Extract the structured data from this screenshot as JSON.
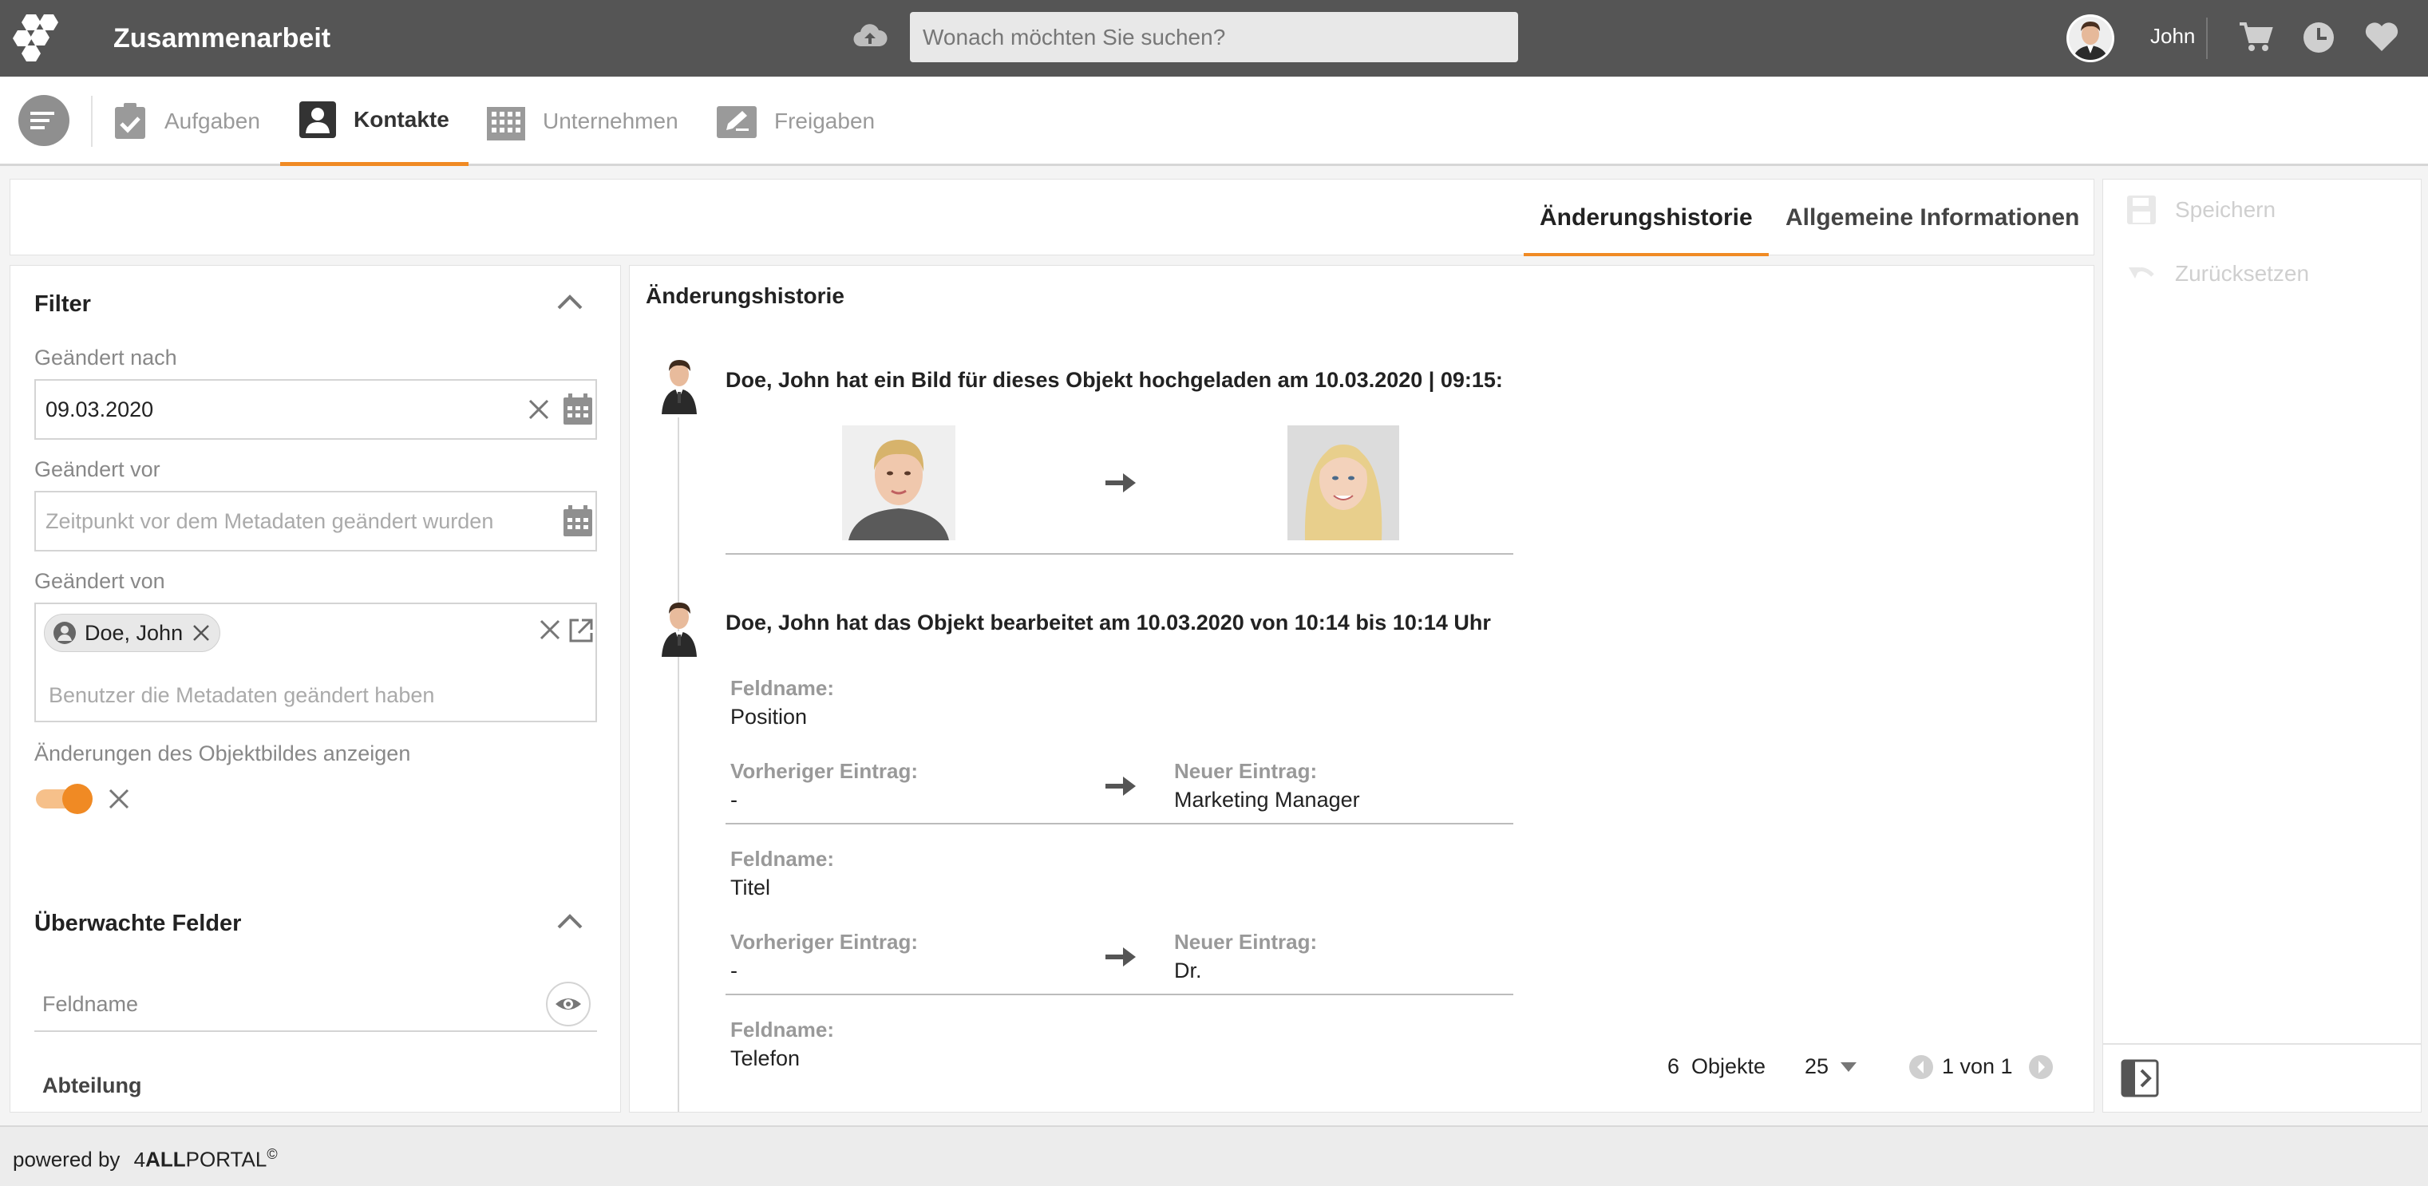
{
  "app": {
    "title": "Zusammenarbeit",
    "search_placeholder": "Wonach möchten Sie suchen?",
    "user_name": "John",
    "accent_color": "#f08a24"
  },
  "nav": {
    "tabs": [
      {
        "label": "Aufgaben",
        "icon": "clipboard-check-icon"
      },
      {
        "label": "Kontakte",
        "icon": "contact-icon",
        "active": true
      },
      {
        "label": "Unternehmen",
        "icon": "building-icon"
      },
      {
        "label": "Freigaben",
        "icon": "share-edit-icon"
      }
    ]
  },
  "subtabs": {
    "history": "Änderungshistorie",
    "general": "Allgemeine Informationen"
  },
  "actions": {
    "save": "Speichern",
    "reset": "Zurücksetzen"
  },
  "filter": {
    "title": "Filter",
    "changed_after_label": "Geändert nach",
    "changed_after_value": "09.03.2020",
    "changed_before_label": "Geändert vor",
    "changed_before_placeholder": "Zeitpunkt vor dem Metadaten geändert wurden",
    "changed_by_label": "Geändert von",
    "changed_by_chip": "Doe, John",
    "changed_by_placeholder": "Benutzer die Metadaten geändert haben",
    "show_image_changes_label": "Änderungen des Objektbildes anzeigen",
    "show_image_changes_on": true
  },
  "watched": {
    "title": "Überwachte Felder",
    "field_placeholder": "Feldname",
    "first_item": "Abteilung"
  },
  "history": {
    "title": "Änderungshistorie",
    "event1": "Doe, John hat ein Bild für dieses Objekt hochgeladen am 10.03.2020 | 09:15:",
    "event2": "Doe, John hat das Objekt bearbeitet am 10.03.2020 von 10:14 bis 10:14 Uhr",
    "field_label": "Feldname:",
    "prev_label": "Vorheriger Eintrag:",
    "new_label": "Neuer Eintrag:",
    "changes": [
      {
        "field": "Position",
        "prev": "-",
        "new": "Marketing Manager"
      },
      {
        "field": "Titel",
        "prev": "-",
        "new": "Dr."
      },
      {
        "field": "Telefon"
      }
    ]
  },
  "pager": {
    "count": "6",
    "count_label": "Objekte",
    "per_page": "25",
    "page_info": "1 von 1"
  },
  "footer": {
    "powered_by": "powered by",
    "brand_prefix": "4",
    "brand_bold": "ALL",
    "brand_suffix": "PORTAL",
    "copyright": "©"
  }
}
